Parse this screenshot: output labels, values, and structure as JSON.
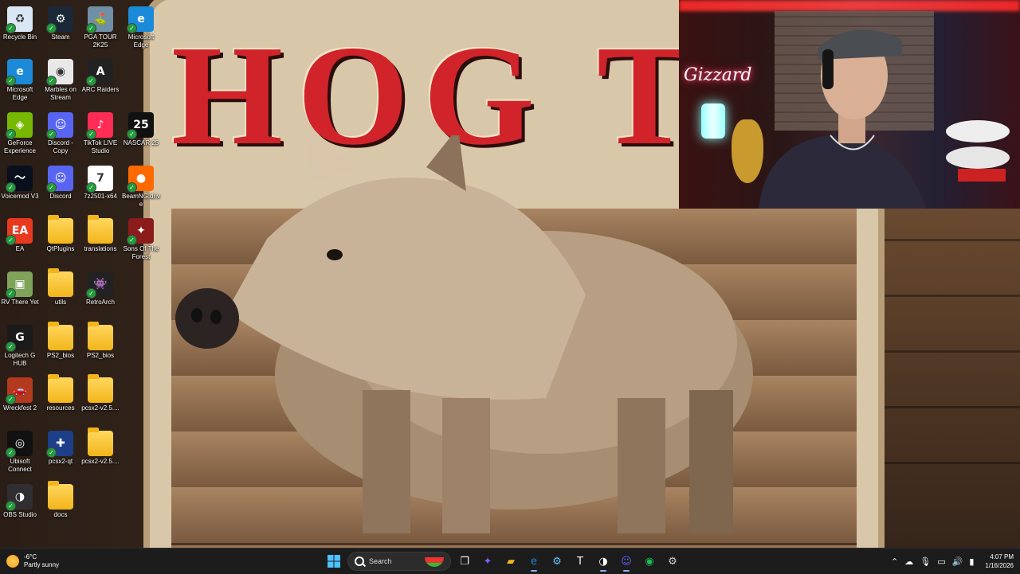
{
  "desktop": {
    "icons": [
      {
        "label": "Recycle Bin",
        "icon": "recycle-bin-icon",
        "color": "#d9e7f5",
        "glyph": "♻"
      },
      {
        "label": "Steam",
        "icon": "steam-icon",
        "color": "#1b2838",
        "glyph": "⚙"
      },
      {
        "label": "PGA TOUR 2K25",
        "icon": "pga-tour-icon",
        "color": "#6e8fa6",
        "glyph": "⛳"
      },
      {
        "label": "Microsoft Edge",
        "icon": "edge-icon",
        "color": "#1b8ad8",
        "glyph": "e"
      },
      {
        "label": "Microsoft Edge",
        "icon": "edge-icon",
        "color": "#1b8ad8",
        "glyph": "e"
      },
      {
        "label": "Marbles on Stream",
        "icon": "marbles-icon",
        "color": "#e8e8e8",
        "glyph": "◉"
      },
      {
        "label": "ARC Raiders",
        "icon": "arc-raiders-icon",
        "color": "#222222",
        "glyph": "A"
      },
      {
        "label": "GeForce Experience",
        "icon": "geforce-icon",
        "color": "#76b900",
        "glyph": "◈"
      },
      {
        "label": "Discord - Copy",
        "icon": "discord-icon",
        "color": "#5865f2",
        "glyph": "☺"
      },
      {
        "label": "TikTok LIVE Studio",
        "icon": "tiktok-icon",
        "color": "#ff2c55",
        "glyph": "♪"
      },
      {
        "label": "NASCAR 25",
        "icon": "nascar-icon",
        "color": "#111111",
        "glyph": "25"
      },
      {
        "label": "Voicemod V3",
        "icon": "voicemod-icon",
        "color": "#0a0f1e",
        "glyph": "〜"
      },
      {
        "label": "Discord",
        "icon": "discord-icon",
        "color": "#5865f2",
        "glyph": "☺"
      },
      {
        "label": "7z2501-x64",
        "icon": "7zip-icon",
        "color": "#ffffff",
        "glyph": "7"
      },
      {
        "label": "BeamNG.drive",
        "icon": "beamng-icon",
        "color": "#ff6a00",
        "glyph": "●"
      },
      {
        "label": "EA",
        "icon": "ea-icon",
        "color": "#e8391e",
        "glyph": "EA"
      },
      {
        "label": "QtPlugins",
        "icon": "folder-icon",
        "color": "folder",
        "glyph": ""
      },
      {
        "label": "translations",
        "icon": "folder-icon",
        "color": "folder",
        "glyph": ""
      },
      {
        "label": "Sons Of The Forest",
        "icon": "sons-forest-icon",
        "color": "#8a1c1c",
        "glyph": "✦"
      },
      {
        "label": "RV There Yet",
        "icon": "rv-there-yet-icon",
        "color": "#7fa35a",
        "glyph": "▣"
      },
      {
        "label": "utils",
        "icon": "folder-icon",
        "color": "folder",
        "glyph": ""
      },
      {
        "label": "RetroArch",
        "icon": "retroarch-icon",
        "color": "#222222",
        "glyph": "👾"
      },
      {
        "label": "Logitech G HUB",
        "icon": "logitech-icon",
        "color": "#1a1a1a",
        "glyph": "G"
      },
      {
        "label": "PS2_bios",
        "icon": "folder-icon",
        "color": "folder",
        "glyph": ""
      },
      {
        "label": "PS2_bios",
        "icon": "folder-icon",
        "color": "folder",
        "glyph": ""
      },
      {
        "label": "Wreckfest 2",
        "icon": "wreckfest-icon",
        "color": "#b33a1e",
        "glyph": "🚗"
      },
      {
        "label": "resources",
        "icon": "folder-icon",
        "color": "folder",
        "glyph": ""
      },
      {
        "label": "pcsx2-v2.5....",
        "icon": "folder-icon",
        "color": "folder",
        "glyph": ""
      },
      {
        "label": "Ubisoft Connect",
        "icon": "ubisoft-icon",
        "color": "#111111",
        "glyph": "◎"
      },
      {
        "label": "pcsx2-qt",
        "icon": "pcsx2-icon",
        "color": "#1d3f8a",
        "glyph": "✚"
      },
      {
        "label": "pcsx2-v2.5....",
        "icon": "folder-icon",
        "color": "folder",
        "glyph": ""
      },
      {
        "label": "OBS Studio",
        "icon": "obs-icon",
        "color": "#302e31",
        "glyph": "◑"
      },
      {
        "label": "docs",
        "icon": "folder-icon",
        "color": "folder",
        "glyph": ""
      }
    ]
  },
  "wallpaper": {
    "title": "HOG TAI"
  },
  "webcam": {
    "neon_sign": "Gizzard"
  },
  "taskbar": {
    "weather_temp": "-6°C",
    "weather_desc": "Partly sunny",
    "search_placeholder": "Search",
    "apps": [
      {
        "name": "start-button",
        "glyph": "⊞",
        "color": "#4cc2ff"
      },
      {
        "name": "task-view-button",
        "glyph": "❐",
        "color": "#ffffff"
      },
      {
        "name": "copilot-app",
        "glyph": "✦",
        "color": "#7b61ff"
      },
      {
        "name": "file-explorer-app",
        "glyph": "▰",
        "color": "#f2b51a"
      },
      {
        "name": "edge-app",
        "glyph": "e",
        "color": "#1b8ad8"
      },
      {
        "name": "steam-app",
        "glyph": "⚙",
        "color": "#66c0f4"
      },
      {
        "name": "tf-app",
        "glyph": "T",
        "color": "#ffffff"
      },
      {
        "name": "obs-app",
        "glyph": "◑",
        "color": "#ffffff"
      },
      {
        "name": "discord-app",
        "glyph": "☺",
        "color": "#5865f2"
      },
      {
        "name": "spotify-app",
        "glyph": "◉",
        "color": "#1db954"
      },
      {
        "name": "settings-app",
        "glyph": "⚙",
        "color": "#cccccc"
      }
    ],
    "time": "4:07 PM",
    "date": "1/16/2026"
  }
}
